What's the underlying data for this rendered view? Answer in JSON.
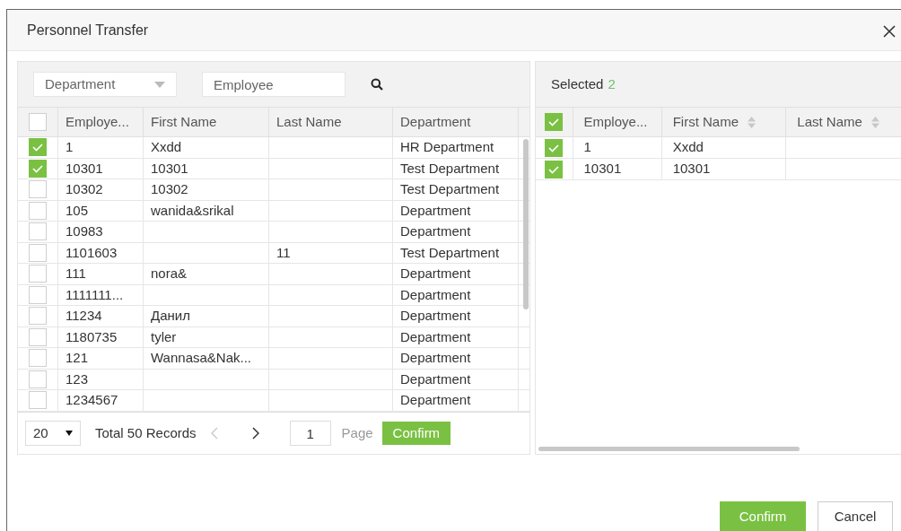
{
  "window": {
    "title": "Personnel Transfer"
  },
  "left_panel": {
    "department_select": {
      "placeholder": "Department"
    },
    "employee_search": {
      "placeholder": "Employee"
    },
    "header_checked": false,
    "columns": [
      "Employe...",
      "First Name",
      "Last Name",
      "Department"
    ],
    "rows": [
      {
        "checked": true,
        "cells": [
          "1",
          "Xxdd",
          "",
          "HR Department"
        ]
      },
      {
        "checked": true,
        "cells": [
          "10301",
          "10301",
          "",
          "Test Department"
        ]
      },
      {
        "checked": false,
        "cells": [
          "10302",
          "10302",
          "",
          "Test Department"
        ]
      },
      {
        "checked": false,
        "cells": [
          "105",
          "wanida&srikal",
          "",
          "Department"
        ]
      },
      {
        "checked": false,
        "cells": [
          "10983",
          "",
          "",
          "Department"
        ]
      },
      {
        "checked": false,
        "cells": [
          "1101603",
          "",
          "11",
          "Test Department"
        ]
      },
      {
        "checked": false,
        "cells": [
          "111",
          "nora&",
          "",
          "Department"
        ]
      },
      {
        "checked": false,
        "cells": [
          "1111111...",
          "",
          "",
          "Department"
        ]
      },
      {
        "checked": false,
        "cells": [
          "11234",
          "Данил",
          "",
          "Department"
        ]
      },
      {
        "checked": false,
        "cells": [
          "1180735",
          "tyler",
          "",
          "Department"
        ]
      },
      {
        "checked": false,
        "cells": [
          "121",
          "Wannasa&Nak...",
          "",
          "Department"
        ]
      },
      {
        "checked": false,
        "cells": [
          "123",
          "",
          "",
          "Department"
        ]
      },
      {
        "checked": false,
        "cells": [
          "1234567",
          "",
          "",
          "Department"
        ]
      }
    ],
    "pagination": {
      "page_size": "20",
      "total": "Total 50 Records",
      "page": "1",
      "page_label": "Page",
      "confirm": "Confirm"
    }
  },
  "right_panel": {
    "selected_label": "Selected",
    "selected_count": "2",
    "header_checked": true,
    "columns": [
      {
        "label": "Employe...",
        "sortable": false
      },
      {
        "label": "First Name",
        "sortable": true
      },
      {
        "label": "Last Name",
        "sortable": true
      }
    ],
    "rows": [
      {
        "checked": true,
        "cells": [
          "1",
          "Xxdd",
          ""
        ]
      },
      {
        "checked": true,
        "cells": [
          "10301",
          "10301",
          ""
        ]
      }
    ]
  },
  "buttons": [
    {
      "label": "Confirm",
      "kind": "primary"
    },
    {
      "label": "Cancel",
      "kind": "secondary"
    }
  ]
}
